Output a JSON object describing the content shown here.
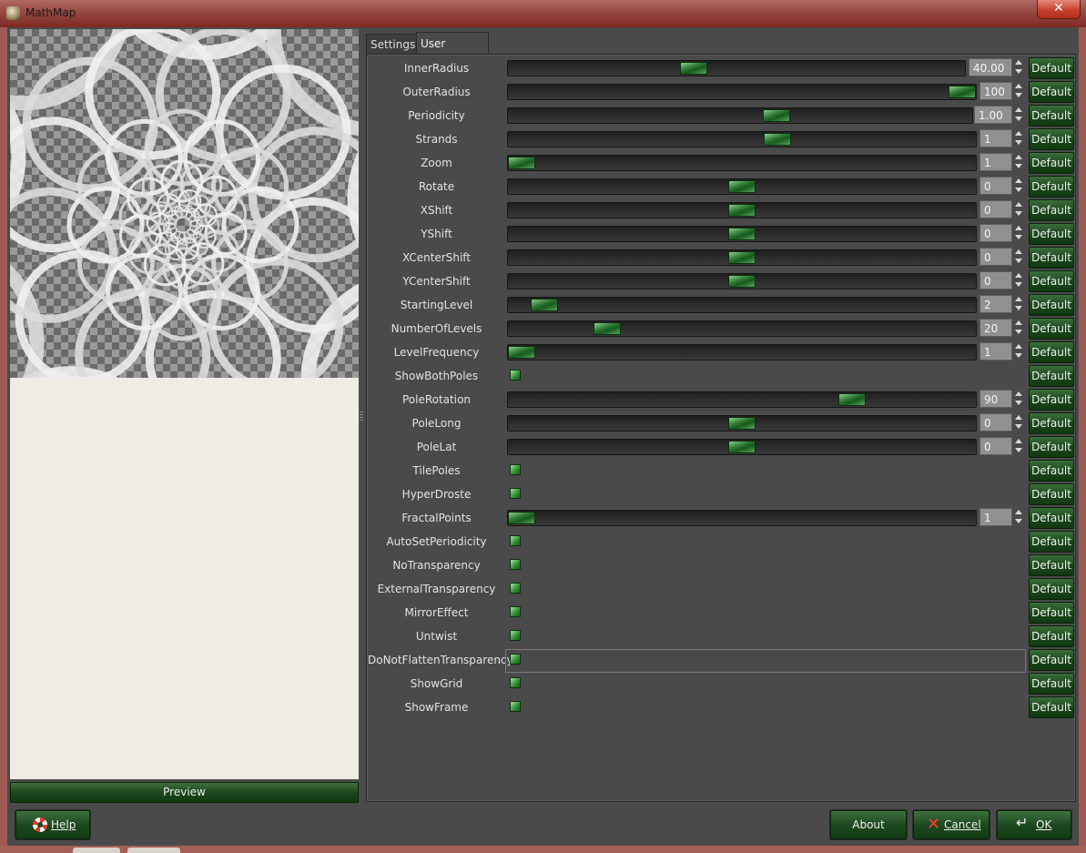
{
  "window": {
    "title": "MathMap",
    "close_glyph": "✕"
  },
  "preview": {
    "button_label": "Preview"
  },
  "tabs": [
    {
      "label": "Settings"
    },
    {
      "label": "User Values"
    }
  ],
  "default_label": "Default",
  "params": [
    {
      "label": "InnerRadius",
      "kind": "slider",
      "value": "40.00",
      "pos": 0.4,
      "wide": true
    },
    {
      "label": "OuterRadius",
      "kind": "slider",
      "value": "100",
      "pos": 1.0
    },
    {
      "label": "Periodicity",
      "kind": "slider",
      "value": "1.00",
      "pos": 0.583,
      "mid": true
    },
    {
      "label": "Strands",
      "kind": "slider",
      "value": "1",
      "pos": 0.58
    },
    {
      "label": "Zoom",
      "kind": "slider",
      "value": "1",
      "pos": 0.0
    },
    {
      "label": "Rotate",
      "kind": "slider",
      "value": "0",
      "pos": 0.5
    },
    {
      "label": "XShift",
      "kind": "slider",
      "value": "0",
      "pos": 0.5
    },
    {
      "label": "YShift",
      "kind": "slider",
      "value": "0",
      "pos": 0.5
    },
    {
      "label": "XCenterShift",
      "kind": "slider",
      "value": "0",
      "pos": 0.5
    },
    {
      "label": "YCenterShift",
      "kind": "slider",
      "value": "0",
      "pos": 0.5
    },
    {
      "label": "StartingLevel",
      "kind": "slider",
      "value": "2",
      "pos": 0.052
    },
    {
      "label": "NumberOfLevels",
      "kind": "slider",
      "value": "20",
      "pos": 0.194
    },
    {
      "label": "LevelFrequency",
      "kind": "slider",
      "value": "1",
      "pos": 0.0
    },
    {
      "label": "ShowBothPoles",
      "kind": "checkbox"
    },
    {
      "label": "PoleRotation",
      "kind": "slider",
      "value": "90",
      "pos": 0.75
    },
    {
      "label": "PoleLong",
      "kind": "slider",
      "value": "0",
      "pos": 0.5
    },
    {
      "label": "PoleLat",
      "kind": "slider",
      "value": "0",
      "pos": 0.5
    },
    {
      "label": "TilePoles",
      "kind": "checkbox"
    },
    {
      "label": "HyperDroste",
      "kind": "checkbox"
    },
    {
      "label": "FractalPoints",
      "kind": "slider",
      "value": "1",
      "pos": 0.0
    },
    {
      "label": "AutoSetPeriodicity",
      "kind": "checkbox"
    },
    {
      "label": "NoTransparency",
      "kind": "checkbox"
    },
    {
      "label": "ExternalTransparency",
      "kind": "checkbox"
    },
    {
      "label": "MirrorEffect",
      "kind": "checkbox"
    },
    {
      "label": "Untwist",
      "kind": "checkbox"
    },
    {
      "label": "DoNotFlattenTransparency",
      "kind": "checkbox"
    },
    {
      "label": "ShowGrid",
      "kind": "checkbox"
    },
    {
      "label": "ShowFrame",
      "kind": "checkbox"
    }
  ],
  "buttons": {
    "help": "Help",
    "about": "About",
    "cancel": "Cancel",
    "ok": "OK"
  },
  "icons": {
    "help": "lifebuoy-icon",
    "cancel": "x-icon",
    "ok": "enter-icon"
  }
}
